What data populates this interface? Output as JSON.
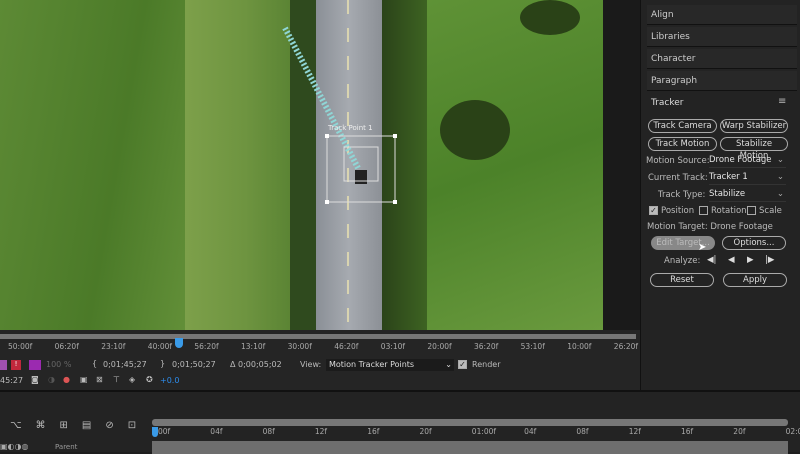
{
  "panel": {
    "tabs": [
      "Align",
      "Libraries",
      "Character",
      "Paragraph"
    ],
    "tracker": {
      "title": "Tracker",
      "menu_icon": "hamburger-menu-icon",
      "buttons": {
        "track_camera": "Track Camera",
        "warp_stabilizer": "Warp Stabilizer",
        "track_motion": "Track Motion",
        "stabilize_motion": "Stabilize Motion"
      },
      "motion_source_label": "Motion Source:",
      "motion_source": "Drone Footage",
      "current_track_label": "Current Track:",
      "current_track": "Tracker 1",
      "track_type_label": "Track Type:",
      "track_type": "Stabilize",
      "position": {
        "label": "Position",
        "checked": true
      },
      "rotation": {
        "label": "Rotation",
        "checked": false
      },
      "scale": {
        "label": "Scale",
        "checked": false
      },
      "motion_target": "Motion Target: Drone Footage",
      "edit_target": "Edit Target...",
      "options": "Options...",
      "analyze_label": "Analyze:",
      "reset": "Reset",
      "apply": "Apply"
    }
  },
  "viewer": {
    "track_point_label": "Track Point 1"
  },
  "timeline_ruler": [
    "50:00f",
    "06:20f",
    "23:10f",
    "40:00f",
    "56:20f",
    "13:10f",
    "30:00f",
    "46:20f",
    "03:10f",
    "20:00f",
    "36:20f",
    "53:10f",
    "10:00f",
    "26:20f"
  ],
  "controls": {
    "zoom": "100 %",
    "in_point": "0;01;45;27",
    "out_point": "0;01;50;27",
    "duration": "Δ 0;00;05;02",
    "view_label": "View:",
    "view": "Motion Tracker Points",
    "render_label": "Render",
    "render_checked": true,
    "timecode": "45:27",
    "exposure": "+0.0"
  },
  "bottom_ruler": [
    "00f",
    "04f",
    "08f",
    "12f",
    "16f",
    "20f",
    "01:00f",
    "04f",
    "08f",
    "12f",
    "16f",
    "20f",
    "02:0"
  ],
  "layer": {
    "parent_label": "Parent"
  },
  "colors": {
    "accent": "#2d8ceb",
    "playhead": "#3a9be8"
  }
}
